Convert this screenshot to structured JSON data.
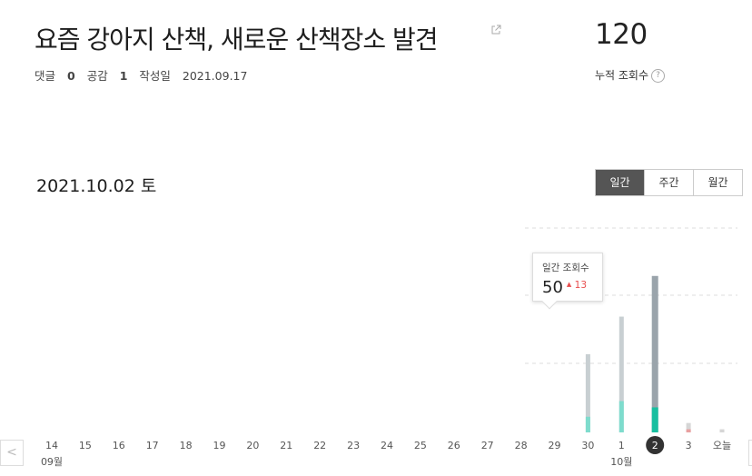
{
  "post": {
    "title": "요즘 강아지 산책, 새로운 산책장소 발견",
    "comments_label": "댓글",
    "comments_count": "0",
    "likes_label": "공감",
    "likes_count": "1",
    "written_label": "작성일",
    "written_date": "2021.09.17"
  },
  "stats": {
    "total_views": "120",
    "total_label": "누적 조회수",
    "help_symbol": "?"
  },
  "selected_date": "2021.10.02 토",
  "tabs": [
    {
      "label": "일간",
      "active": true
    },
    {
      "label": "주간",
      "active": false
    },
    {
      "label": "월간",
      "active": false
    }
  ],
  "tooltip": {
    "label": "일간 조회수",
    "value": "50",
    "change": "13",
    "change_symbol": "▲"
  },
  "nav": {
    "prev_symbol": "<",
    "next_symbol": ">"
  },
  "colors": {
    "accent": "#18bfa0",
    "bar_total_today": "#9aa4ab",
    "bar_total_other": "#c8cfd2",
    "bar_new_other": "#7edccd",
    "bar_tiny": "#e8a0a0",
    "selected_circle": "#333333",
    "tooltip_change": "#e84d4d"
  },
  "chart_data": {
    "type": "bar",
    "categories": [
      "14",
      "15",
      "16",
      "17",
      "18",
      "19",
      "20",
      "21",
      "22",
      "23",
      "24",
      "25",
      "26",
      "27",
      "28",
      "29",
      "30",
      "1",
      "2",
      "3",
      "오늘"
    ],
    "month_labels": [
      {
        "at": "14",
        "label": "09월"
      },
      {
        "at": "1",
        "label": "10월"
      }
    ],
    "selected": "2",
    "series": [
      {
        "values": [
          0,
          0,
          0,
          0,
          0,
          0,
          0,
          0,
          0,
          0,
          0,
          0,
          0,
          0,
          0,
          0,
          25,
          37,
          50,
          3,
          1
        ]
      },
      {
        "values": [
          0,
          0,
          0,
          0,
          0,
          0,
          0,
          0,
          0,
          0,
          0,
          0,
          0,
          0,
          0,
          0,
          5,
          10,
          8,
          1,
          0
        ]
      }
    ],
    "ylim": [
      0,
      54
    ],
    "grid": true
  }
}
